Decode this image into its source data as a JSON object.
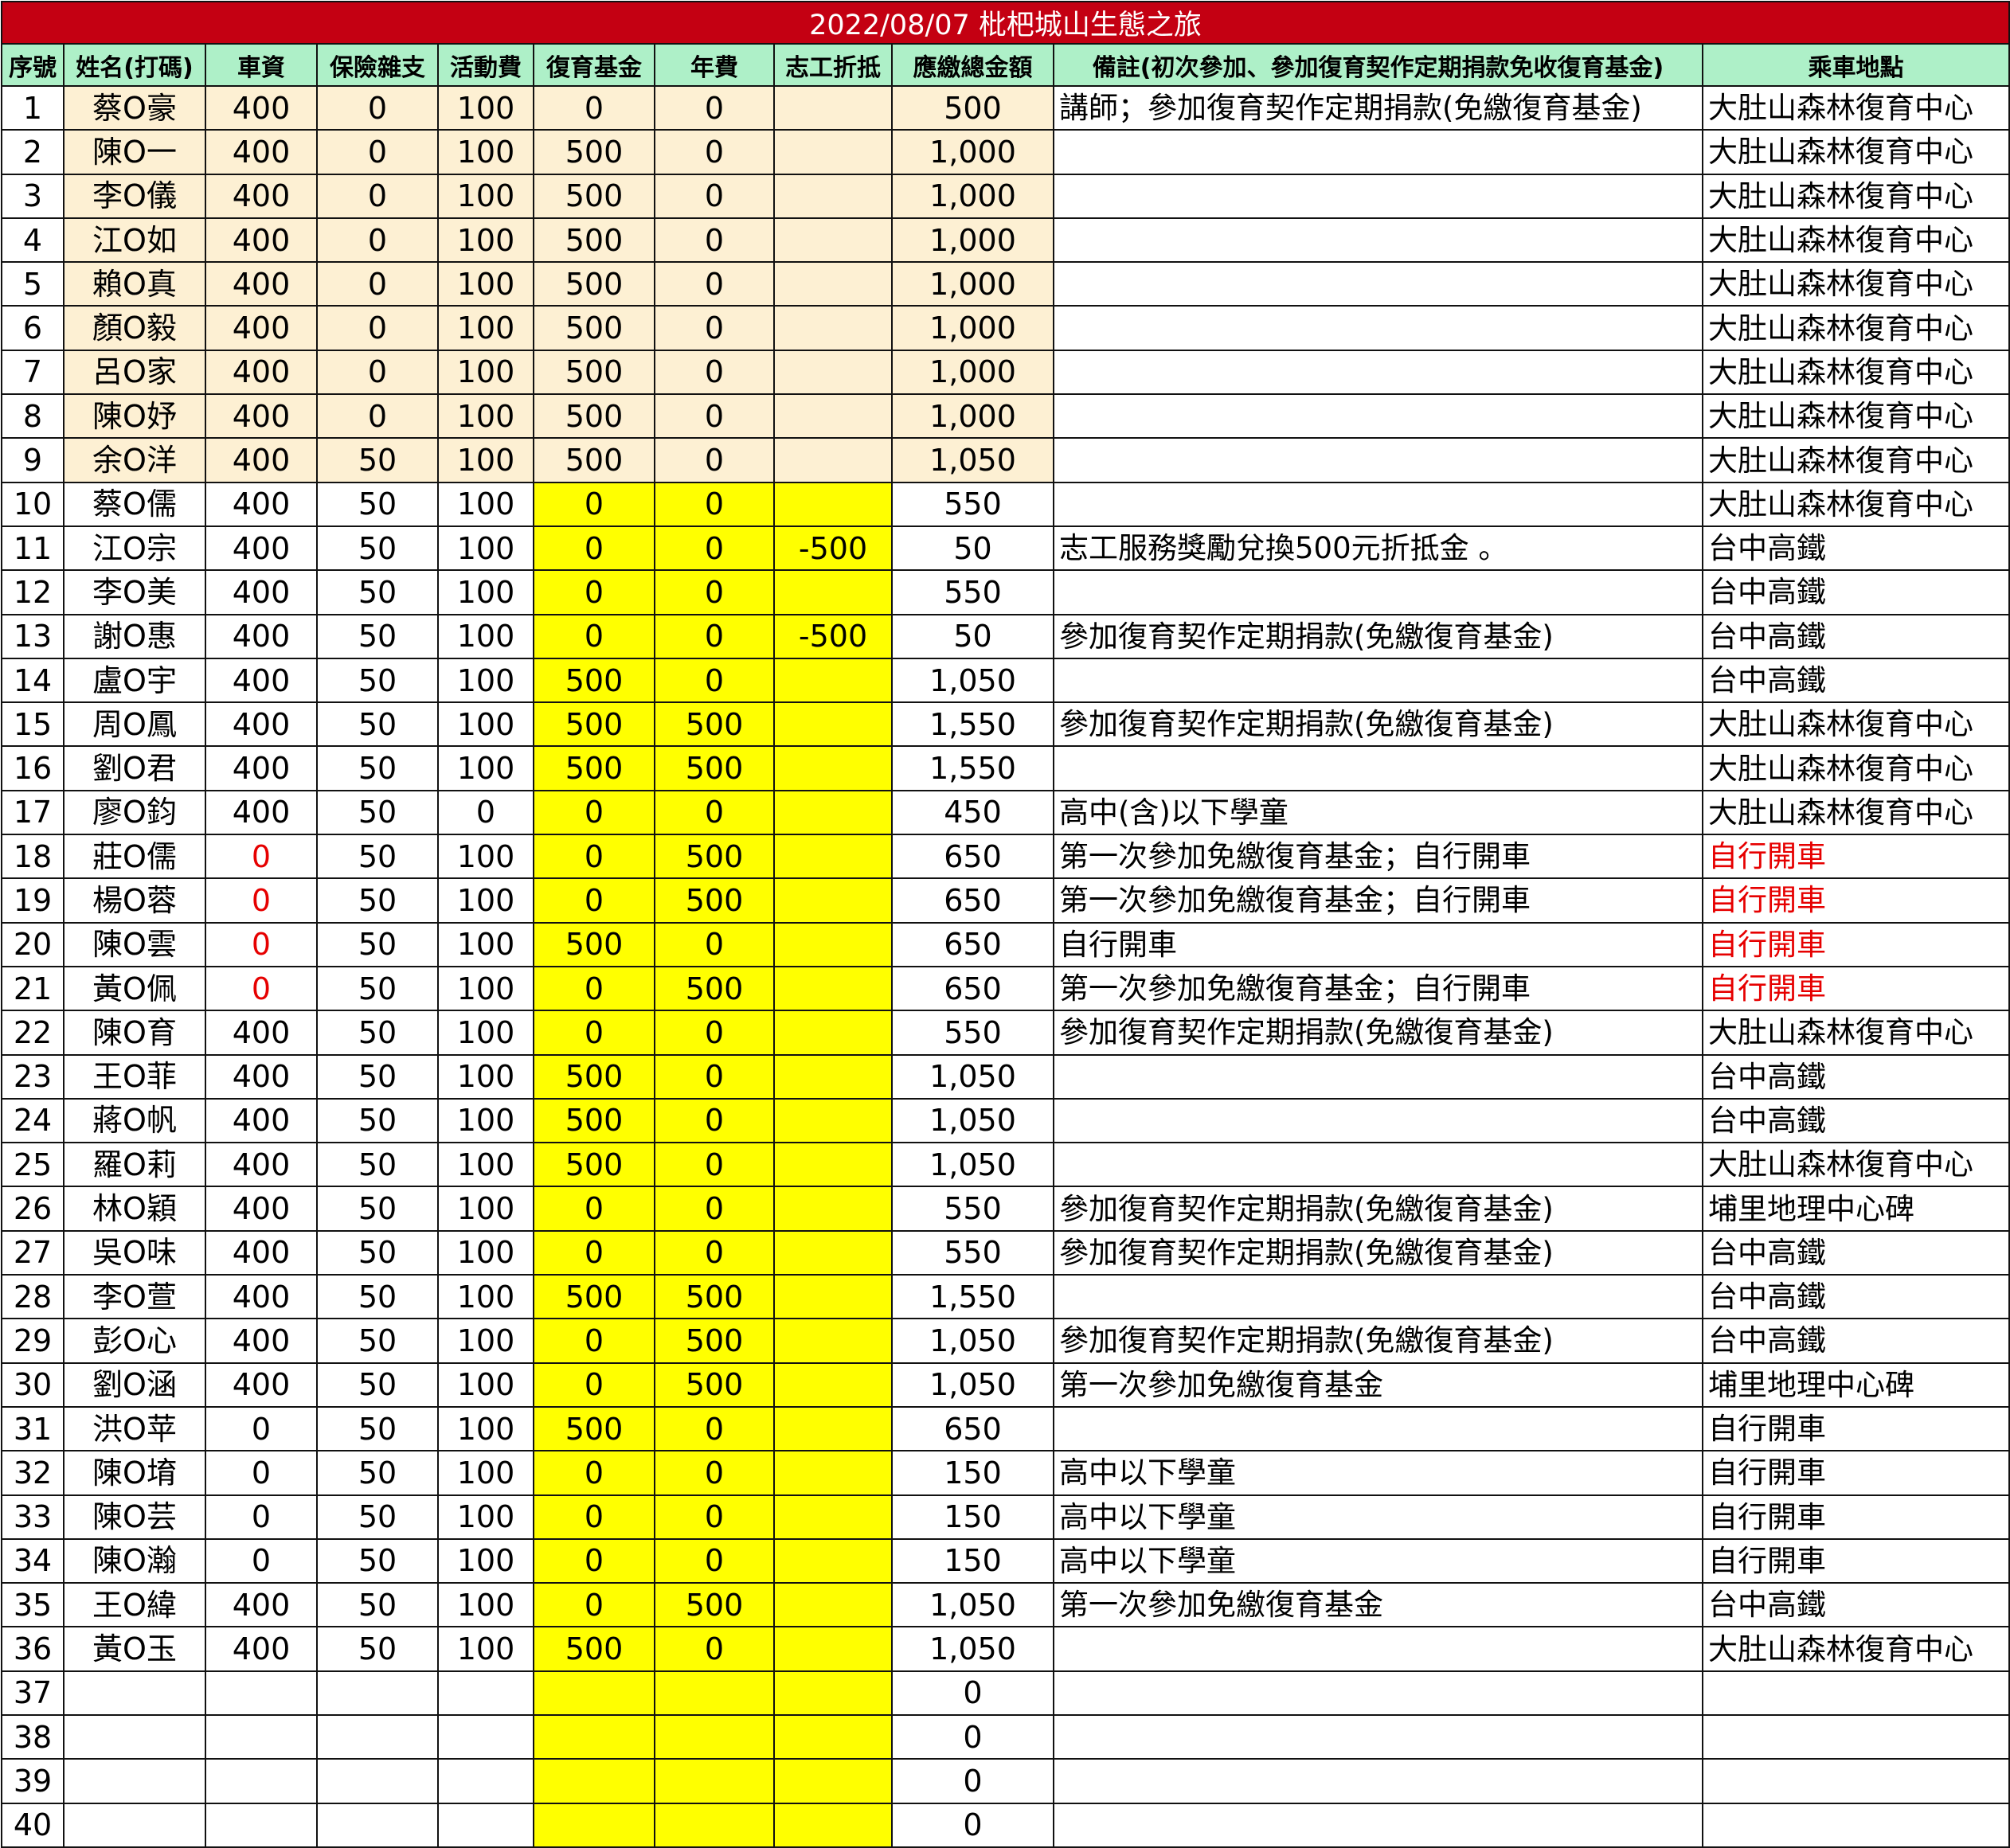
{
  "title": "2022/08/07 枇杷城山生態之旅",
  "headers": [
    "序號",
    "姓名(打碼)",
    "車資",
    "保險雜支",
    "活動費",
    "復育基金",
    "年費",
    "志工折抵",
    "應繳總金額",
    "備註(初次參加、參加復育契作定期捐款免收復育基金)",
    "乘車地點"
  ],
  "rows": [
    {
      "seq": "1",
      "name": "蔡O豪",
      "fare": "400",
      "ins": "0",
      "act": "100",
      "fund": "0",
      "fee": "0",
      "vol": "",
      "total": "500",
      "note": "講師；參加復育契作定期捐款(免繳復育基金)",
      "loc": "大肚山森林復育中心"
    },
    {
      "seq": "2",
      "name": "陳O一",
      "fare": "400",
      "ins": "0",
      "act": "100",
      "fund": "500",
      "fee": "0",
      "vol": "",
      "total": "1,000",
      "note": "",
      "loc": "大肚山森林復育中心"
    },
    {
      "seq": "3",
      "name": "李O儀",
      "fare": "400",
      "ins": "0",
      "act": "100",
      "fund": "500",
      "fee": "0",
      "vol": "",
      "total": "1,000",
      "note": "",
      "loc": "大肚山森林復育中心"
    },
    {
      "seq": "4",
      "name": "江O如",
      "fare": "400",
      "ins": "0",
      "act": "100",
      "fund": "500",
      "fee": "0",
      "vol": "",
      "total": "1,000",
      "note": "",
      "loc": "大肚山森林復育中心"
    },
    {
      "seq": "5",
      "name": "賴O真",
      "fare": "400",
      "ins": "0",
      "act": "100",
      "fund": "500",
      "fee": "0",
      "vol": "",
      "total": "1,000",
      "note": "",
      "loc": "大肚山森林復育中心"
    },
    {
      "seq": "6",
      "name": "顏O毅",
      "fare": "400",
      "ins": "0",
      "act": "100",
      "fund": "500",
      "fee": "0",
      "vol": "",
      "total": "1,000",
      "note": "",
      "loc": "大肚山森林復育中心"
    },
    {
      "seq": "7",
      "name": "呂O家",
      "fare": "400",
      "ins": "0",
      "act": "100",
      "fund": "500",
      "fee": "0",
      "vol": "",
      "total": "1,000",
      "note": "",
      "loc": "大肚山森林復育中心"
    },
    {
      "seq": "8",
      "name": "陳O妤",
      "fare": "400",
      "ins": "0",
      "act": "100",
      "fund": "500",
      "fee": "0",
      "vol": "",
      "total": "1,000",
      "note": "",
      "loc": "大肚山森林復育中心"
    },
    {
      "seq": "9",
      "name": "余O洋",
      "fare": "400",
      "ins": "50",
      "act": "100",
      "fund": "500",
      "fee": "0",
      "vol": "",
      "total": "1,050",
      "note": "",
      "loc": "大肚山森林復育中心"
    },
    {
      "seq": "10",
      "name": "蔡O儒",
      "fare": "400",
      "ins": "50",
      "act": "100",
      "fund": "0",
      "fee": "0",
      "vol": "",
      "total": "550",
      "note": "",
      "loc": "大肚山森林復育中心"
    },
    {
      "seq": "11",
      "name": "江O宗",
      "fare": "400",
      "ins": "50",
      "act": "100",
      "fund": "0",
      "fee": "0",
      "vol": "-500",
      "total": "50",
      "note": "志工服務獎勵兌換500元折抵金 。",
      "loc": "台中高鐵"
    },
    {
      "seq": "12",
      "name": "李O美",
      "fare": "400",
      "ins": "50",
      "act": "100",
      "fund": "0",
      "fee": "0",
      "vol": "",
      "total": "550",
      "note": "",
      "loc": "台中高鐵"
    },
    {
      "seq": "13",
      "name": "謝O惠",
      "fare": "400",
      "ins": "50",
      "act": "100",
      "fund": "0",
      "fee": "0",
      "vol": "-500",
      "total": "50",
      "note": "參加復育契作定期捐款(免繳復育基金)",
      "loc": "台中高鐵"
    },
    {
      "seq": "14",
      "name": "盧O宇",
      "fare": "400",
      "ins": "50",
      "act": "100",
      "fund": "500",
      "fee": "0",
      "vol": "",
      "total": "1,050",
      "note": "",
      "loc": "台中高鐵"
    },
    {
      "seq": "15",
      "name": "周O鳳",
      "fare": "400",
      "ins": "50",
      "act": "100",
      "fund": "500",
      "fee": "500",
      "vol": "",
      "total": "1,550",
      "note": "參加復育契作定期捐款(免繳復育基金)",
      "loc": "大肚山森林復育中心"
    },
    {
      "seq": "16",
      "name": "劉O君",
      "fare": "400",
      "ins": "50",
      "act": "100",
      "fund": "500",
      "fee": "500",
      "vol": "",
      "total": "1,550",
      "note": "",
      "loc": "大肚山森林復育中心"
    },
    {
      "seq": "17",
      "name": "廖O鈞",
      "fare": "400",
      "ins": "50",
      "act": "0",
      "fund": "0",
      "fee": "0",
      "vol": "",
      "total": "450",
      "note": "高中(含)以下學童",
      "loc": "大肚山森林復育中心"
    },
    {
      "seq": "18",
      "name": "莊O儒",
      "fare": "0",
      "ins": "50",
      "act": "100",
      "fund": "0",
      "fee": "500",
      "vol": "",
      "total": "650",
      "note": "第一次參加免繳復育基金；自行開車",
      "loc": "自行開車",
      "red": true
    },
    {
      "seq": "19",
      "name": "楊O蓉",
      "fare": "0",
      "ins": "50",
      "act": "100",
      "fund": "0",
      "fee": "500",
      "vol": "",
      "total": "650",
      "note": "第一次參加免繳復育基金；自行開車",
      "loc": "自行開車",
      "red": true
    },
    {
      "seq": "20",
      "name": "陳O雲",
      "fare": "0",
      "ins": "50",
      "act": "100",
      "fund": "500",
      "fee": "0",
      "vol": "",
      "total": "650",
      "note": "自行開車",
      "loc": "自行開車",
      "red": true
    },
    {
      "seq": "21",
      "name": "黃O佩",
      "fare": "0",
      "ins": "50",
      "act": "100",
      "fund": "0",
      "fee": "500",
      "vol": "",
      "total": "650",
      "note": "第一次參加免繳復育基金；自行開車",
      "loc": "自行開車",
      "red": true
    },
    {
      "seq": "22",
      "name": "陳O育",
      "fare": "400",
      "ins": "50",
      "act": "100",
      "fund": "0",
      "fee": "0",
      "vol": "",
      "total": "550",
      "note": "參加復育契作定期捐款(免繳復育基金)",
      "loc": "大肚山森林復育中心"
    },
    {
      "seq": "23",
      "name": "王O菲",
      "fare": "400",
      "ins": "50",
      "act": "100",
      "fund": "500",
      "fee": "0",
      "vol": "",
      "total": "1,050",
      "note": "",
      "loc": "台中高鐵"
    },
    {
      "seq": "24",
      "name": "蔣O帆",
      "fare": "400",
      "ins": "50",
      "act": "100",
      "fund": "500",
      "fee": "0",
      "vol": "",
      "total": "1,050",
      "note": "",
      "loc": "台中高鐵"
    },
    {
      "seq": "25",
      "name": "羅O莉",
      "fare": "400",
      "ins": "50",
      "act": "100",
      "fund": "500",
      "fee": "0",
      "vol": "",
      "total": "1,050",
      "note": "",
      "loc": "大肚山森林復育中心"
    },
    {
      "seq": "26",
      "name": "林O穎",
      "fare": "400",
      "ins": "50",
      "act": "100",
      "fund": "0",
      "fee": "0",
      "vol": "",
      "total": "550",
      "note": "參加復育契作定期捐款(免繳復育基金)",
      "loc": "埔里地理中心碑"
    },
    {
      "seq": "27",
      "name": "吳O味",
      "fare": "400",
      "ins": "50",
      "act": "100",
      "fund": "0",
      "fee": "0",
      "vol": "",
      "total": "550",
      "note": "參加復育契作定期捐款(免繳復育基金)",
      "loc": "台中高鐵"
    },
    {
      "seq": "28",
      "name": "李O萱",
      "fare": "400",
      "ins": "50",
      "act": "100",
      "fund": "500",
      "fee": "500",
      "vol": "",
      "total": "1,550",
      "note": "",
      "loc": "台中高鐵"
    },
    {
      "seq": "29",
      "name": "彭O心",
      "fare": "400",
      "ins": "50",
      "act": "100",
      "fund": "0",
      "fee": "500",
      "vol": "",
      "total": "1,050",
      "note": "參加復育契作定期捐款(免繳復育基金)",
      "loc": "台中高鐵"
    },
    {
      "seq": "30",
      "name": "劉O涵",
      "fare": "400",
      "ins": "50",
      "act": "100",
      "fund": "0",
      "fee": "500",
      "vol": "",
      "total": "1,050",
      "note": "第一次參加免繳復育基金",
      "loc": "埔里地理中心碑"
    },
    {
      "seq": "31",
      "name": "洪O苹",
      "fare": "0",
      "ins": "50",
      "act": "100",
      "fund": "500",
      "fee": "0",
      "vol": "",
      "total": "650",
      "note": "",
      "loc": "自行開車"
    },
    {
      "seq": "32",
      "name": "陳O堉",
      "fare": "0",
      "ins": "50",
      "act": "100",
      "fund": "0",
      "fee": "0",
      "vol": "",
      "total": "150",
      "note": "高中以下學童",
      "loc": "自行開車"
    },
    {
      "seq": "33",
      "name": "陳O芸",
      "fare": "0",
      "ins": "50",
      "act": "100",
      "fund": "0",
      "fee": "0",
      "vol": "",
      "total": "150",
      "note": "高中以下學童",
      "loc": "自行開車"
    },
    {
      "seq": "34",
      "name": "陳O瀚",
      "fare": "0",
      "ins": "50",
      "act": "100",
      "fund": "0",
      "fee": "0",
      "vol": "",
      "total": "150",
      "note": "高中以下學童",
      "loc": "自行開車"
    },
    {
      "seq": "35",
      "name": "王O緯",
      "fare": "400",
      "ins": "50",
      "act": "100",
      "fund": "0",
      "fee": "500",
      "vol": "",
      "total": "1,050",
      "note": "第一次參加免繳復育基金",
      "loc": "台中高鐵"
    },
    {
      "seq": "36",
      "name": "黃O玉",
      "fare": "400",
      "ins": "50",
      "act": "100",
      "fund": "500",
      "fee": "0",
      "vol": "",
      "total": "1,050",
      "note": "",
      "loc": "大肚山森林復育中心"
    },
    {
      "seq": "37",
      "name": "",
      "fare": "",
      "ins": "",
      "act": "",
      "fund": "",
      "fee": "",
      "vol": "",
      "total": "0",
      "note": "",
      "loc": ""
    },
    {
      "seq": "38",
      "name": "",
      "fare": "",
      "ins": "",
      "act": "",
      "fund": "",
      "fee": "",
      "vol": "",
      "total": "0",
      "note": "",
      "loc": ""
    },
    {
      "seq": "39",
      "name": "",
      "fare": "",
      "ins": "",
      "act": "",
      "fund": "",
      "fee": "",
      "vol": "",
      "total": "0",
      "note": "",
      "loc": ""
    },
    {
      "seq": "40",
      "name": "",
      "fare": "",
      "ins": "",
      "act": "",
      "fund": "",
      "fee": "",
      "vol": "",
      "total": "0",
      "note": "",
      "loc": ""
    }
  ],
  "colors": {
    "title_bg": "#c40012",
    "header_bg": "#aef0c8",
    "peach_cell": "#fdf0d3",
    "yellow_cell": "#ffff00",
    "red_text": "#e60000"
  }
}
